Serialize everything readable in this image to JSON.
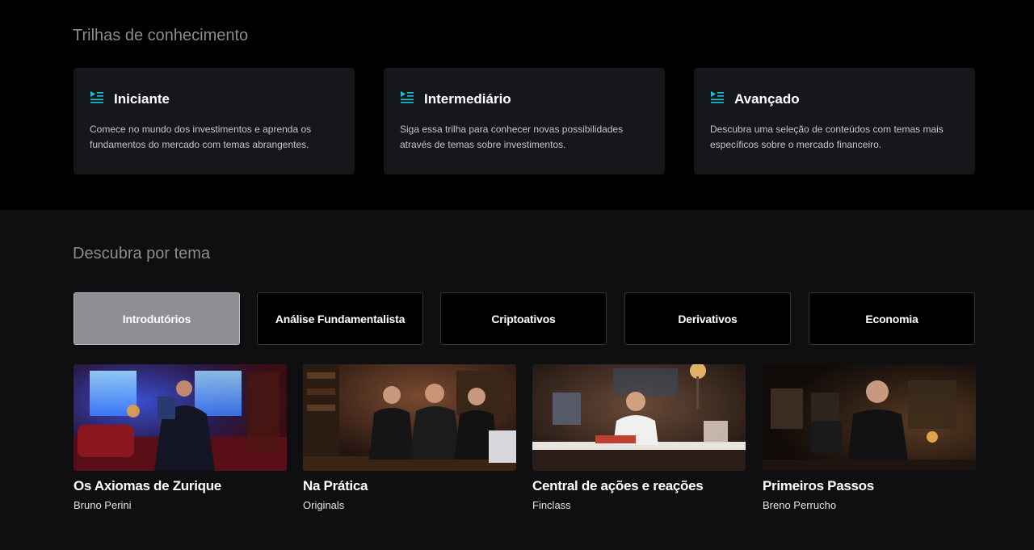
{
  "trails": {
    "heading": "Trilhas de conhecimento",
    "cards": [
      {
        "title": "Iniciante",
        "description": "Comece no mundo dos investimentos e aprenda os fundamentos do mercado com temas abrangentes.",
        "icon": "playlist-icon"
      },
      {
        "title": "Intermediário",
        "description": "Siga essa trilha para conhecer novas possibilidades através de temas sobre investimentos.",
        "icon": "playlist-icon"
      },
      {
        "title": "Avançado",
        "description": "Descubra uma seleção de conteúdos com temas mais específicos sobre o mercado financeiro.",
        "icon": "playlist-icon"
      }
    ]
  },
  "topics": {
    "heading": "Descubra por tema",
    "tabs": [
      {
        "label": "Introdutórios",
        "active": true
      },
      {
        "label": "Análise Fundamentalista",
        "active": false
      },
      {
        "label": "Criptoativos",
        "active": false
      },
      {
        "label": "Derivativos",
        "active": false
      },
      {
        "label": "Economia",
        "active": false
      }
    ],
    "courses": [
      {
        "title": "Os Axiomas de Zurique",
        "author": "Bruno Perini"
      },
      {
        "title": "Na Prática",
        "author": "Originals"
      },
      {
        "title": "Central de ações e reações",
        "author": "Finclass"
      },
      {
        "title": "Primeiros Passos",
        "author": "Breno Perruchо"
      }
    ]
  },
  "colors": {
    "accent": "#19c3d9",
    "page_background_top": "#000000",
    "page_background_bottom": "#0f0f11",
    "card_background": "#16171b",
    "active_tab": "#8e8e93"
  }
}
